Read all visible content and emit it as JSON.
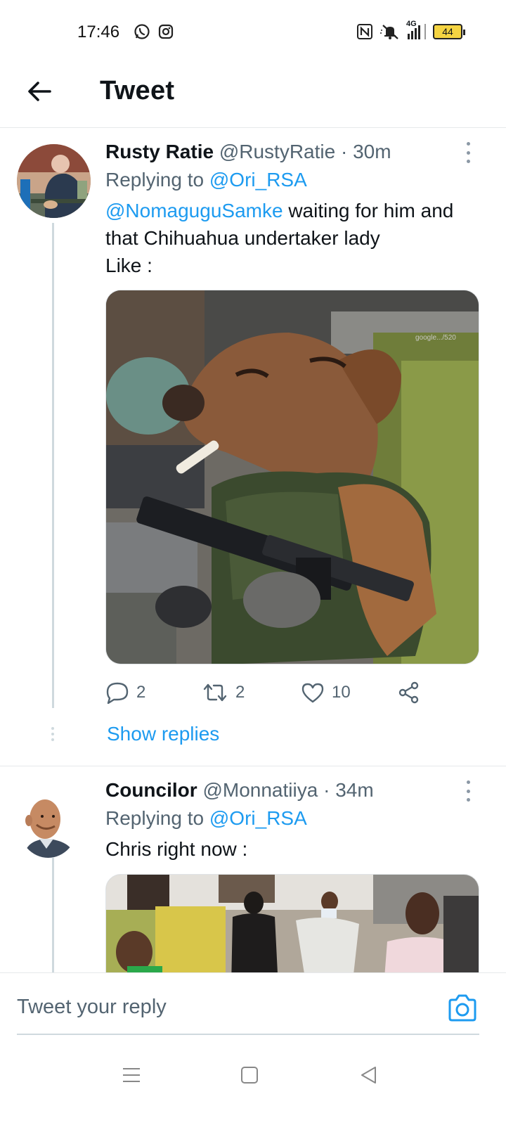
{
  "status_bar": {
    "time": "17:46",
    "battery": "44",
    "network": "4G",
    "left_icons": [
      "whatsapp-icon",
      "instagram-icon"
    ],
    "right_icons": [
      "nfc-icon",
      "mute-icon",
      "signal-icon",
      "battery-icon"
    ]
  },
  "app_bar": {
    "title": "Tweet",
    "back_icon": "arrow-left-icon"
  },
  "tweets": [
    {
      "name": "Rusty Ratie",
      "handle": "@RustyRatie",
      "separator": "·",
      "time": "30m",
      "replying_prefix": "Replying to",
      "replying_to": "@Ori_RSA",
      "mention": "@NomaguguSamke",
      "text_after_mention": " waiting for him and that Chihuahua undertaker lady",
      "text_line_last": "Like :",
      "media_description": "chihuahua-with-cigarette-and-rifle",
      "media_watermark": "google.../520",
      "replies": "2",
      "retweets": "2",
      "likes": "10",
      "show_replies": "Show replies"
    },
    {
      "name": "Councilor",
      "handle": "@Monnatiiya",
      "separator": "·",
      "time": "34m",
      "replying_prefix": "Replying to",
      "replying_to": "@Ori_RSA",
      "text": "Chris right now :",
      "media_description": "people-running-video-still"
    }
  ],
  "composer": {
    "placeholder": "Tweet your reply",
    "camera_icon": "camera-icon"
  },
  "nav_bar": {
    "icons": [
      "menu-icon",
      "home-square-icon",
      "back-triangle-icon"
    ]
  },
  "colors": {
    "accent": "#1d9bf0",
    "secondary_text": "#536471",
    "divider": "#e6e9eb"
  }
}
